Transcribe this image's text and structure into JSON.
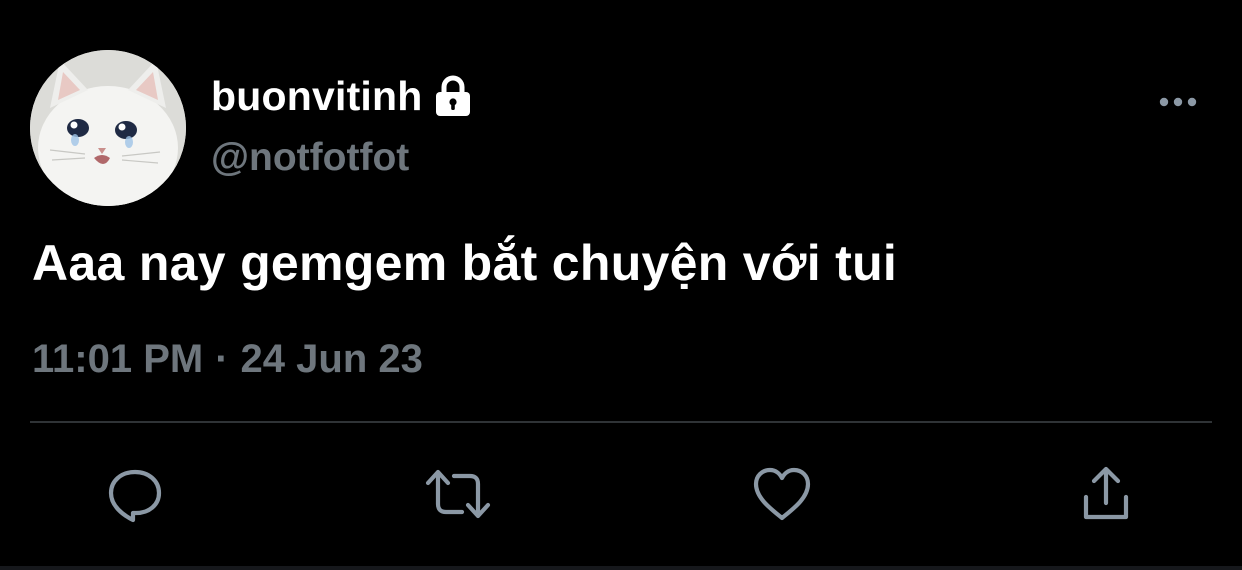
{
  "user": {
    "display_name": "buonvitinh",
    "handle": "@notfotfot",
    "avatar_icon": "crying-cat-avatar",
    "protected_icon": "lock-icon"
  },
  "tweet": {
    "text": "Aaa nay gemgem bắt chuyện với tui",
    "time": "11:01 PM",
    "separator": "·",
    "date": "24 Jun 23"
  },
  "actions": [
    {
      "name": "reply",
      "icon": "reply-icon"
    },
    {
      "name": "retweet",
      "icon": "retweet-icon"
    },
    {
      "name": "like",
      "icon": "heart-icon"
    },
    {
      "name": "share",
      "icon": "share-icon"
    }
  ],
  "menu_icon": "more-dots-icon",
  "colors": {
    "background": "#000000",
    "primary_text": "#ffffff",
    "secondary_text": "#6e767d",
    "divider": "#2f3336",
    "icon": "#8b98a5"
  }
}
